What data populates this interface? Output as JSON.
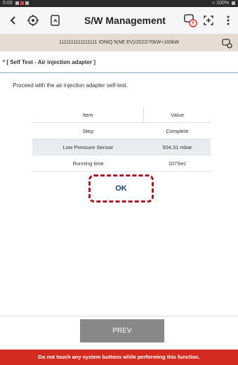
{
  "status_bar": {
    "time": "5:00",
    "battery": "100%"
  },
  "header": {
    "title": "S/W Management"
  },
  "vehicle": {
    "info": "1111111111111111 IONIQ 5(NE EV)/2022/70kW+160kW"
  },
  "section": {
    "title": "* [ Self Test - Air injection adapter ]"
  },
  "description": "Proceed with the air injection adapter self-test.",
  "table": {
    "headers": [
      "Item",
      "Value"
    ],
    "rows": [
      {
        "item": "Step",
        "value": "Complete"
      },
      {
        "item": "Low Pressure Sensor",
        "value": "504.31 mbar"
      },
      {
        "item": "Running time",
        "value": "107Sec"
      }
    ]
  },
  "buttons": {
    "ok": "OK",
    "prev": "PREV"
  },
  "warning": "Do not touch any system buttons while performing this function.",
  "colors": {
    "warning_bg": "#d32b20",
    "vehicle_bar_bg": "#e6dcd2",
    "ok_text": "#243a7a",
    "highlight": "#a41d2a"
  }
}
